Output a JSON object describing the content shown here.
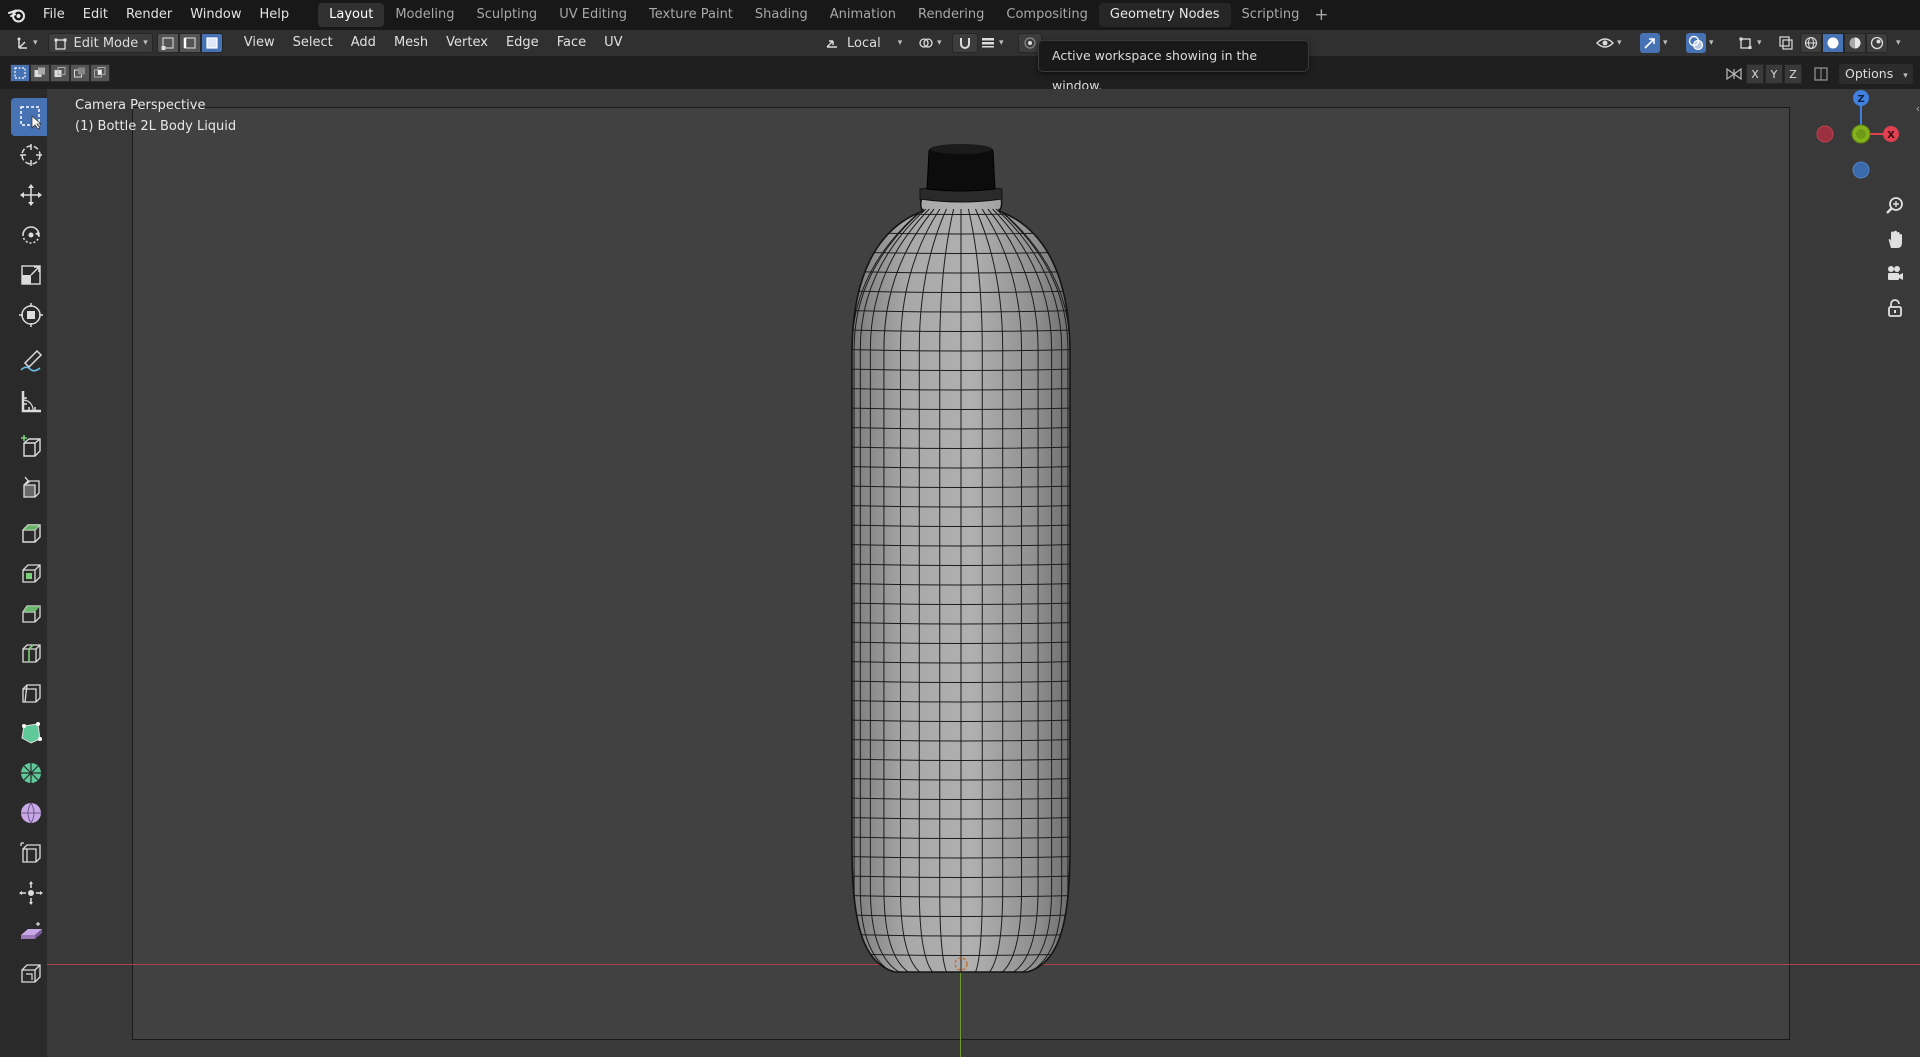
{
  "menubar": {
    "items": [
      "File",
      "Edit",
      "Render",
      "Window",
      "Help"
    ]
  },
  "workspaces": {
    "tabs": [
      "Layout",
      "Modeling",
      "Sculpting",
      "UV Editing",
      "Texture Paint",
      "Shading",
      "Animation",
      "Rendering",
      "Compositing",
      "Geometry Nodes",
      "Scripting"
    ],
    "active": "Layout",
    "add": "+"
  },
  "header": {
    "mode": "Edit Mode",
    "menus": [
      "View",
      "Select",
      "Add",
      "Mesh",
      "Vertex",
      "Edge",
      "Face",
      "UV"
    ],
    "transform_orientation": "Local",
    "mesh_select_mode": "face"
  },
  "tooltip": {
    "text": "Active workspace showing in the window."
  },
  "viewport": {
    "view_name": "Camera Perspective",
    "object_label": "(1) Bottle 2L Body Liquid"
  },
  "row2": {
    "axis_x": "X",
    "axis_y": "Y",
    "axis_z": "Z",
    "options": "Options"
  },
  "gizmo": {
    "z_label": "Z",
    "x_label": "X",
    "colors": {
      "x": "#e0404f",
      "y": "#83b21b",
      "z": "#4080e0",
      "neg_x": "#9a3040",
      "neg_z": "#3a6aaa"
    }
  },
  "toolbar": {
    "active_tool": "select-box",
    "tools": [
      "select-box",
      "cursor",
      "move",
      "rotate",
      "scale",
      "transform",
      "annotate",
      "measure",
      "add-cube",
      "extrude-region",
      "inset-faces",
      "bevel",
      "loop-cut",
      "knife",
      "poly-build",
      "spin",
      "smooth",
      "edge-slide",
      "shrink-fatten",
      "shear",
      "rip-region"
    ]
  },
  "colors": {
    "accent": "#4772b3",
    "background": "#393939",
    "camera_frame": "#414141",
    "mesh_fill": "#9e9e9e",
    "x_axis_line": "#b83a3a"
  }
}
